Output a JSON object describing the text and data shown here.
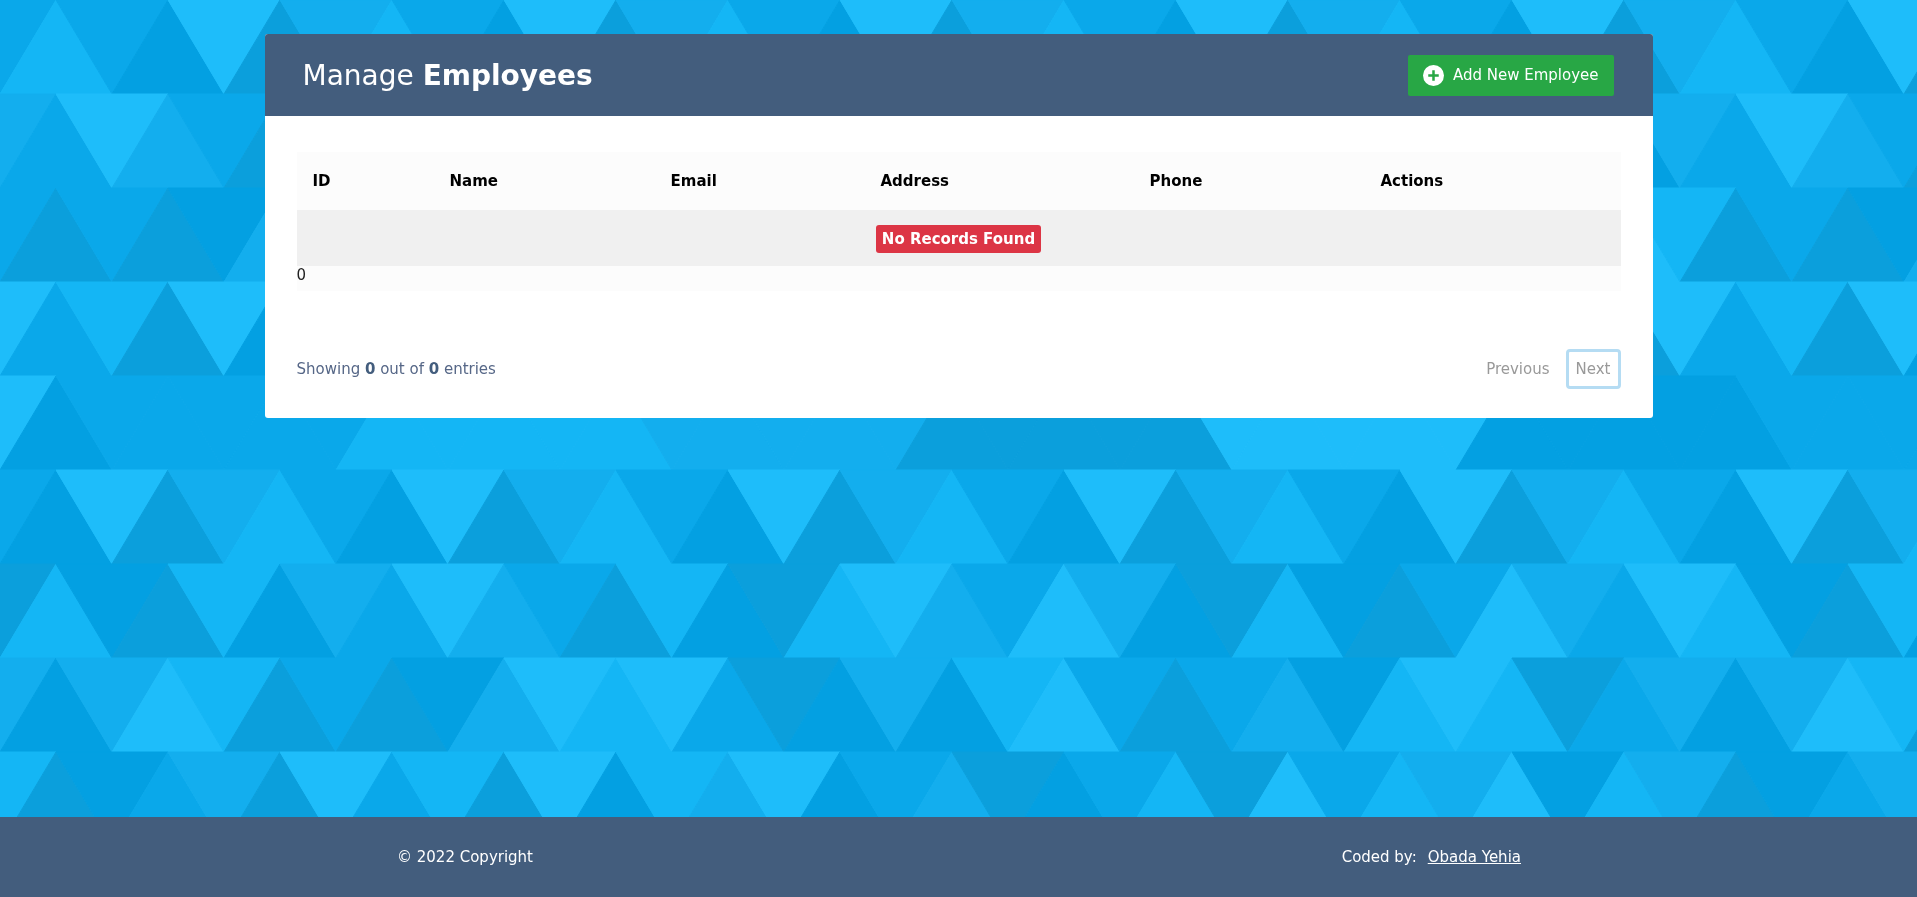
{
  "panel": {
    "title": "Manage **Employees**",
    "add_button": "Add New Employee"
  },
  "table": {
    "columns": [
      "ID",
      "Name",
      "Email",
      "Address",
      "Phone",
      "Actions"
    ],
    "empty_message": "No Records Found",
    "count": "0"
  },
  "summary": "Showing **0** out of **0** entries",
  "pagination": [
    {
      "label": "Previous",
      "focused": false
    },
    {
      "label": "Next",
      "focused": true
    }
  ],
  "footer": {
    "copyright": "© 2022 Copyright",
    "credit_label": "Coded by:",
    "author_link": "Obada Yehia"
  }
}
